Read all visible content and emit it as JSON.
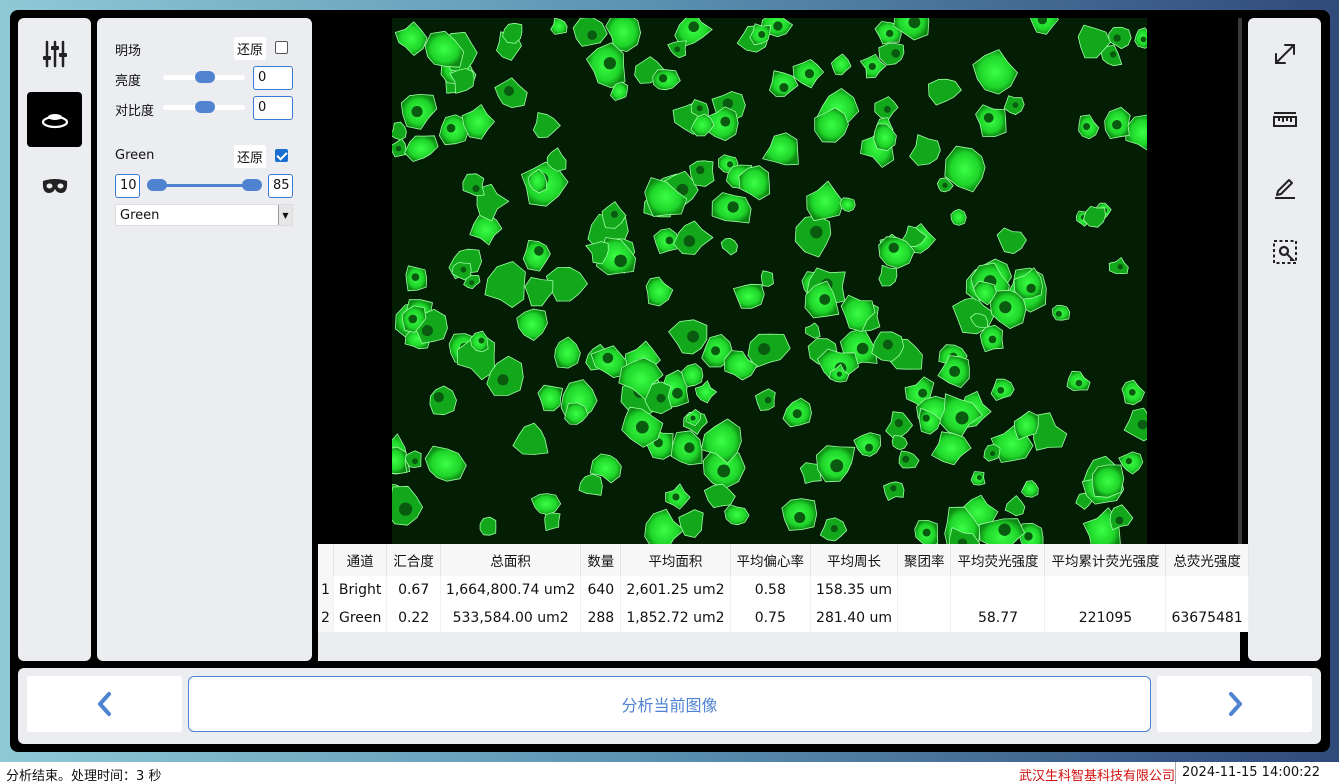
{
  "left_toolbar": {
    "items": [
      {
        "icon": "sliders-icon",
        "active": false
      },
      {
        "icon": "ring-layers-icon",
        "active": true
      },
      {
        "icon": "mask-icon",
        "active": false
      }
    ]
  },
  "controls": {
    "brightfield": {
      "label": "明场",
      "restore_label": "还原",
      "checked": false,
      "brightness_label": "亮度",
      "brightness_value": "0",
      "contrast_label": "对比度",
      "contrast_value": "0"
    },
    "green": {
      "label": "Green",
      "restore_label": "还原",
      "checked": true,
      "min_value": "10",
      "max_value": "85",
      "color_select": "Green"
    }
  },
  "right_toolbar": {
    "items": [
      {
        "icon": "expand-icon"
      },
      {
        "icon": "ruler-icon"
      },
      {
        "icon": "pen-icon"
      },
      {
        "icon": "roi-select-icon"
      }
    ]
  },
  "results_table": {
    "headers": [
      "通道",
      "汇合度",
      "总面积",
      "数量",
      "平均面积",
      "平均偏心率",
      "平均周长",
      "聚团率",
      "平均荧光强度",
      "平均累计荧光强度",
      "总荧光强度"
    ],
    "rows": [
      {
        "index": "1",
        "cells": [
          "Bright",
          "0.67",
          "1,664,800.74 um2",
          "640",
          "2,601.25 um2",
          "0.58",
          "158.35 um",
          "",
          "",
          "",
          ""
        ]
      },
      {
        "index": "2",
        "cells": [
          "Green",
          "0.22",
          "533,584.00 um2",
          "288",
          "1,852.72 um2",
          "0.75",
          "281.40 um",
          "",
          "58.77",
          "221095",
          "63675481"
        ]
      }
    ]
  },
  "bottom": {
    "prev_icon": "chevron-left-icon",
    "analyze_label": "分析当前图像",
    "next_icon": "chevron-right-icon"
  },
  "status": {
    "message": "分析结束。处理时间：3 秒",
    "company": "武汉生科智基科技有限公司",
    "datetime": "2024-11-15 14:00:22"
  },
  "colors": {
    "accent": "#4f83d1",
    "cell_fluorescence": "#22e52a",
    "company_text": "#d01010"
  }
}
